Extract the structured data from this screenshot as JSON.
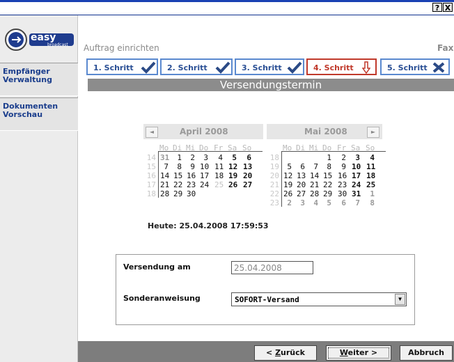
{
  "window": {
    "help_label": "?",
    "close_label": "X"
  },
  "logo": {
    "brand": "easy",
    "sub": "broadcast"
  },
  "sidebar": {
    "items": [
      {
        "line1": "Empfänger",
        "line2": "Verwaltung"
      },
      {
        "line1": "Dokumenten",
        "line2": "Vorschau"
      }
    ]
  },
  "header": {
    "title": "Auftrag einrichten",
    "type": "Fax"
  },
  "steps": [
    {
      "label": "1. Schritt",
      "status": "done"
    },
    {
      "label": "2. Schritt",
      "status": "done"
    },
    {
      "label": "3. Schritt",
      "status": "done"
    },
    {
      "label": "4. Schritt",
      "status": "current"
    },
    {
      "label": "5. Schritt",
      "status": "pending"
    }
  ],
  "section_title": "Versendungstermin",
  "calendar": {
    "dow": [
      "Mo",
      "Di",
      "Mi",
      "Do",
      "Fr",
      "Sa",
      "So"
    ],
    "months": [
      {
        "title": "April 2008",
        "weeks": [
          {
            "wk": "14",
            "days": [
              "31",
              "1",
              "2",
              "3",
              "4",
              "5",
              "6"
            ]
          },
          {
            "wk": "15",
            "days": [
              "7",
              "8",
              "9",
              "10",
              "11",
              "12",
              "13"
            ]
          },
          {
            "wk": "16",
            "days": [
              "14",
              "15",
              "16",
              "17",
              "18",
              "19",
              "20"
            ]
          },
          {
            "wk": "17",
            "days": [
              "21",
              "22",
              "23",
              "24",
              "25",
              "26",
              "27"
            ]
          },
          {
            "wk": "18",
            "days": [
              "28",
              "29",
              "30",
              "",
              "",
              "",
              ""
            ]
          }
        ]
      },
      {
        "title": "Mai 2008",
        "weeks": [
          {
            "wk": "18",
            "days": [
              "",
              "",
              "",
              "1",
              "2",
              "3",
              "4"
            ]
          },
          {
            "wk": "19",
            "days": [
              "5",
              "6",
              "7",
              "8",
              "9",
              "10",
              "11"
            ]
          },
          {
            "wk": "20",
            "days": [
              "12",
              "13",
              "14",
              "15",
              "16",
              "17",
              "18"
            ]
          },
          {
            "wk": "21",
            "days": [
              "19",
              "20",
              "21",
              "22",
              "23",
              "24",
              "25"
            ]
          },
          {
            "wk": "22",
            "days": [
              "26",
              "27",
              "28",
              "29",
              "30",
              "31",
              "1"
            ]
          },
          {
            "wk": "23",
            "days": [
              "2",
              "3",
              "4",
              "5",
              "6",
              "7",
              "8"
            ]
          }
        ]
      }
    ],
    "today_label": "Heute: 25.04.2008 17:59:53"
  },
  "form": {
    "date_label": "Versendung am",
    "date_value": "25.04.2008",
    "instruction_label": "Sonderanweisung",
    "instruction_value": "SOFORT-Versand"
  },
  "buttons": {
    "back_mn": "Z",
    "back_rest": "urück",
    "next_mn": "W",
    "next_rest": "eiter >",
    "cancel": "Abbruch"
  }
}
